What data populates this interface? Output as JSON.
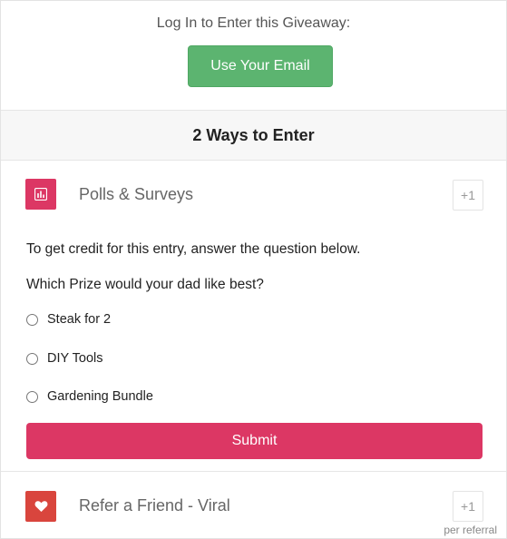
{
  "login": {
    "prompt": "Log In to Enter this Giveaway:",
    "email_button": "Use Your Email"
  },
  "ways": {
    "header": "2 Ways to Enter"
  },
  "entries": [
    {
      "title": "Polls & Surveys",
      "points": "+1",
      "icon": "bar-chart-icon",
      "icon_color": "#dc3764",
      "instruction": "To get credit for this entry, answer the question below.",
      "question": "Which Prize would your dad like best?",
      "options": [
        "Steak for 2",
        "DIY Tools",
        "Gardening Bundle"
      ],
      "submit_label": "Submit"
    },
    {
      "title": "Refer a Friend - Viral",
      "points": "+1",
      "points_note": "per referral",
      "icon": "heart-icon",
      "icon_color": "#d9453d"
    }
  ],
  "colors": {
    "email_button": "#5cb470",
    "submit_button": "#dc3764"
  }
}
